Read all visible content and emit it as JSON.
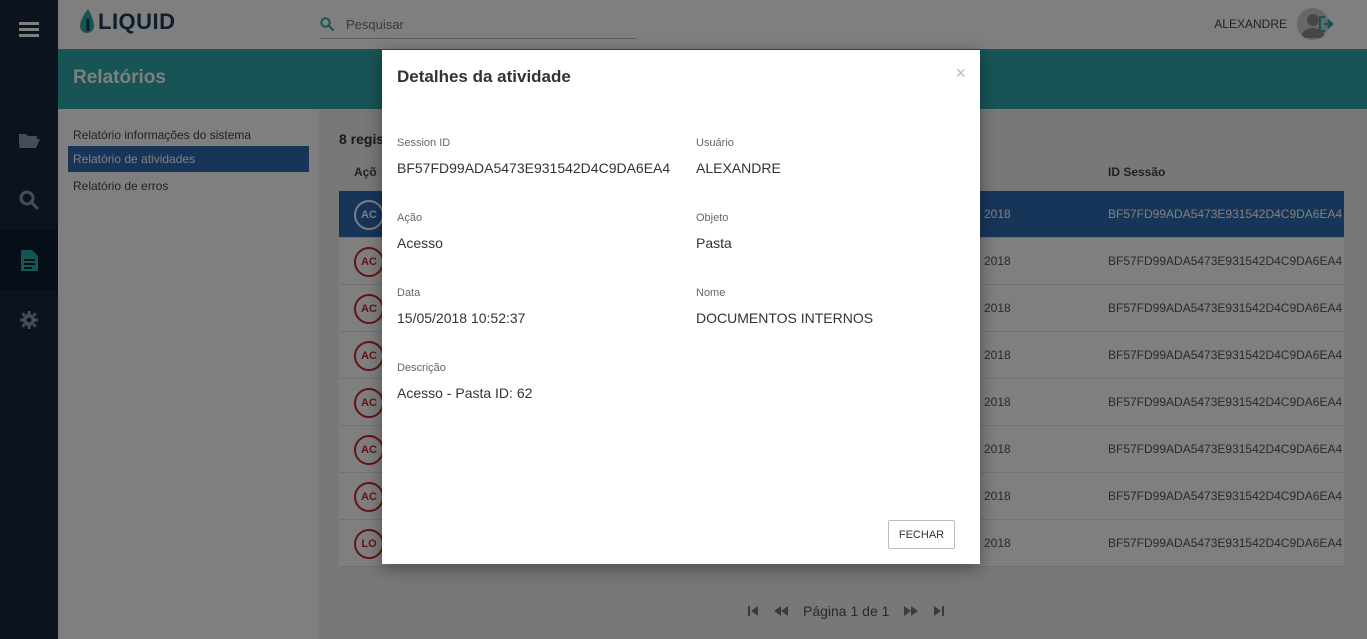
{
  "app": {
    "logo_text": "LIQUID"
  },
  "search": {
    "placeholder": "Pesquisar"
  },
  "user": {
    "name": "ALEXANDRE"
  },
  "header": {
    "title": "Relatórios"
  },
  "report_menu": {
    "items": [
      {
        "label": "Relatório informações do sistema"
      },
      {
        "label": "Relatório de atividades"
      },
      {
        "label": "Relatório de erros"
      }
    ]
  },
  "table": {
    "count_text": "8 regis",
    "columns": {
      "action": "Açõ",
      "session": "ID Sessão"
    },
    "rows": [
      {
        "badge": "AC",
        "date": "2018",
        "session_id": "BF57FD99ADA5473E931542D4C9DA6EA4",
        "selected": true
      },
      {
        "badge": "AC",
        "date": "2018",
        "session_id": "BF57FD99ADA5473E931542D4C9DA6EA4"
      },
      {
        "badge": "AC",
        "date": "2018",
        "session_id": "BF57FD99ADA5473E931542D4C9DA6EA4"
      },
      {
        "badge": "AC",
        "date": "2018",
        "session_id": "BF57FD99ADA5473E931542D4C9DA6EA4"
      },
      {
        "badge": "AC",
        "date": "2018",
        "session_id": "BF57FD99ADA5473E931542D4C9DA6EA4"
      },
      {
        "badge": "AC",
        "date": "2018",
        "session_id": "BF57FD99ADA5473E931542D4C9DA6EA4"
      },
      {
        "badge": "AC",
        "date": "2018",
        "session_id": "BF57FD99ADA5473E931542D4C9DA6EA4"
      },
      {
        "badge": "LO",
        "date": "2018",
        "session_id": "BF57FD99ADA5473E931542D4C9DA6EA4"
      }
    ]
  },
  "pagination": {
    "text": "Página 1 de 1"
  },
  "modal": {
    "title": "Detalhes da atividade",
    "close_symbol": "×",
    "fields": {
      "session_id": {
        "label": "Session ID",
        "value": "BF57FD99ADA5473E931542D4C9DA6EA4"
      },
      "usuario": {
        "label": "Usuário",
        "value": "ALEXANDRE"
      },
      "acao": {
        "label": "Ação",
        "value": "Acesso"
      },
      "objeto": {
        "label": "Objeto",
        "value": "Pasta"
      },
      "data": {
        "label": "Data",
        "value": "15/05/2018 10:52:37"
      },
      "nome": {
        "label": "Nome",
        "value": "DOCUMENTOS INTERNOS"
      },
      "descricao": {
        "label": "Descrição",
        "value": "Acesso - Pasta ID: 62"
      }
    },
    "close_button": "FECHAR"
  },
  "colors": {
    "sidebar": "#17293c",
    "header_teal": "#2fa9ad",
    "selected_blue": "#2e6bb3",
    "badge_red": "#c62828"
  },
  "icons": [
    "menu-icon",
    "folder-icon",
    "search-icon",
    "document-icon",
    "settings-icon",
    "logout-icon",
    "first-page-icon",
    "prev-page-icon",
    "next-page-icon",
    "last-page-icon"
  ]
}
